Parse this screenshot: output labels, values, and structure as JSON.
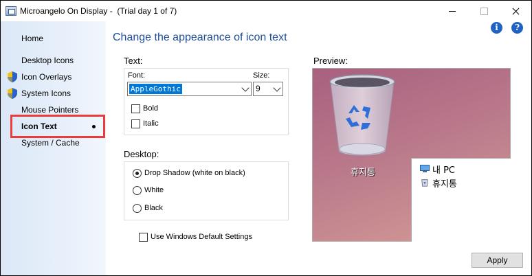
{
  "window": {
    "title": "Microangelo On Display -  (Trial day 1 of 7)"
  },
  "sidebar": {
    "items": [
      {
        "label": "Home",
        "icon": ""
      },
      {
        "label": "Desktop Icons",
        "icon": ""
      },
      {
        "label": "Icon Overlays",
        "icon": "uac-shield-icon"
      },
      {
        "label": "System Icons",
        "icon": "uac-shield-icon"
      },
      {
        "label": "Mouse Pointers",
        "icon": ""
      },
      {
        "label": "Icon Text",
        "icon": "",
        "active": true
      },
      {
        "label": "System / Cache",
        "icon": ""
      }
    ],
    "highlight_color": "#ec3b3b"
  },
  "main": {
    "title": "Change the appearance of icon text",
    "text_section": {
      "label": "Text:",
      "font_label": "Font:",
      "font_value": "AppleGothic",
      "size_label": "Size:",
      "size_value": "9",
      "bold_label": "Bold",
      "italic_label": "Italic"
    },
    "desktop_section": {
      "label": "Desktop:",
      "options": [
        {
          "label": "Drop Shadow (white on black)",
          "checked": true
        },
        {
          "label": "White",
          "checked": false
        },
        {
          "label": "Black",
          "checked": false
        }
      ]
    },
    "use_default_label": "Use Windows Default Settings",
    "preview": {
      "label": "Preview:",
      "bin_label": "휴지통",
      "explorer_items": [
        {
          "label": "내 PC",
          "icon": "this-pc-icon"
        },
        {
          "label": "휴지통",
          "icon": "recycle-bin-icon"
        }
      ]
    },
    "apply_label": "Apply"
  },
  "colors": {
    "accent": "#1e4e9a",
    "selection": "#0078d7",
    "help_icon": "#1e63c4"
  }
}
